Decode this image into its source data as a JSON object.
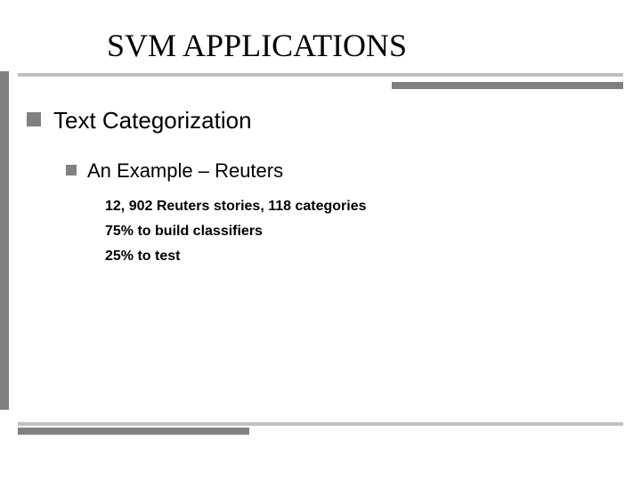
{
  "title": "SVM APPLICATIONS",
  "level1": {
    "text": "Text Categorization"
  },
  "level2": {
    "text": "An Example – Reuters"
  },
  "level3": [
    "12, 902 Reuters stories, 118 categories",
    "75% to build classifiers",
    "25% to test"
  ]
}
